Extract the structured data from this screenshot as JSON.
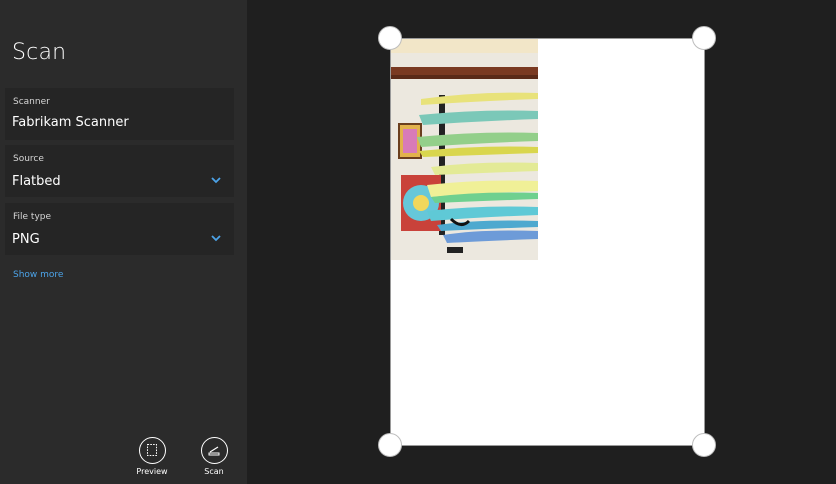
{
  "sidebar": {
    "title": "Scan",
    "scanner": {
      "label": "Scanner",
      "value": "Fabrikam Scanner"
    },
    "source": {
      "label": "Source",
      "value": "Flatbed"
    },
    "file_type": {
      "label": "File type",
      "value": "PNG"
    },
    "show_more": "Show more"
  },
  "commands": {
    "preview": "Preview",
    "scan": "Scan"
  },
  "colors": {
    "accent": "#4ca3e8",
    "sidebar_bg": "#2b2b2b",
    "stage_bg": "#1f1f1f"
  },
  "icons": {
    "dropdown": "chevron-down-icon",
    "preview": "preview-icon",
    "scan": "scan-icon",
    "crop_handle": "crop-handle"
  }
}
